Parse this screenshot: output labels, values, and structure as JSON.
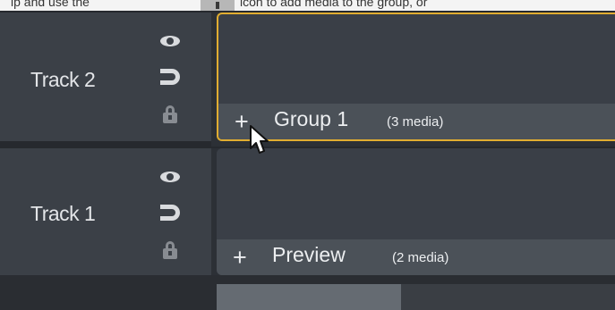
{
  "top_hint": {
    "text": "ip and use the",
    "text_after": "icon to add media to the group, or"
  },
  "tracks": [
    {
      "label": "Track 2",
      "clip": {
        "plus": "+",
        "name": "Group 1",
        "count": "(3 media)",
        "selected": true
      }
    },
    {
      "label": "Track 1",
      "clip": {
        "plus": "+",
        "name": "Preview",
        "count": "(2 media)",
        "selected": false
      }
    }
  ],
  "icons": [
    "eye-icon",
    "magnet-icon",
    "lock-icon"
  ],
  "colors": {
    "selected_border": "#e1ad31",
    "header_bg": "#3b4047",
    "clip_bg": "#3a3f47",
    "clip_bar": "#4b5158"
  }
}
